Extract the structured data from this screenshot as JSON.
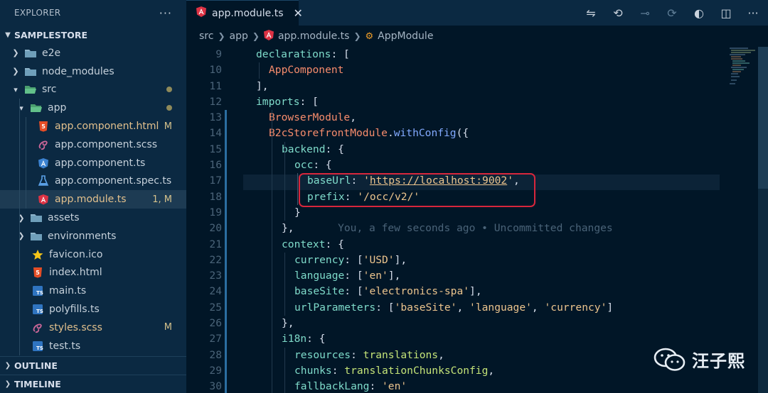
{
  "sidebar": {
    "title": "EXPLORER",
    "more": "···",
    "project": "SAMPLESTORE",
    "items": [
      {
        "label": "e2e",
        "icon": "folder-icon",
        "type": "folder",
        "level": 1,
        "open": false
      },
      {
        "label": "node_modules",
        "icon": "folder-icon",
        "type": "folder",
        "level": 1,
        "open": false
      },
      {
        "label": "src",
        "icon": "folder-open-icon",
        "type": "folder",
        "level": 1,
        "open": true,
        "dot": true
      },
      {
        "label": "app",
        "icon": "folder-open-icon",
        "type": "folder",
        "level": 2,
        "open": true,
        "dot": true
      },
      {
        "label": "app.component.html",
        "icon": "html-icon",
        "type": "file",
        "level": 3,
        "badge": "M"
      },
      {
        "label": "app.component.scss",
        "icon": "sass-icon",
        "type": "file",
        "level": 3
      },
      {
        "label": "app.component.ts",
        "icon": "angular-component-icon",
        "type": "file",
        "level": 3
      },
      {
        "label": "app.component.spec.ts",
        "icon": "test-flask-icon",
        "type": "file",
        "level": 3
      },
      {
        "label": "app.module.ts",
        "icon": "angular-icon",
        "type": "file",
        "level": 3,
        "badge": "1, M",
        "selected": true
      },
      {
        "label": "assets",
        "icon": "folder-icon",
        "type": "folder",
        "level": 2,
        "open": false
      },
      {
        "label": "environments",
        "icon": "folder-icon",
        "type": "folder",
        "level": 2,
        "open": false
      },
      {
        "label": "favicon.ico",
        "icon": "star-icon",
        "type": "file",
        "level": 2
      },
      {
        "label": "index.html",
        "icon": "html-icon",
        "type": "file",
        "level": 2
      },
      {
        "label": "main.ts",
        "icon": "typescript-icon",
        "type": "file",
        "level": 2
      },
      {
        "label": "polyfills.ts",
        "icon": "typescript-icon",
        "type": "file",
        "level": 2
      },
      {
        "label": "styles.scss",
        "icon": "sass-icon",
        "type": "file",
        "level": 2,
        "badge": "M"
      },
      {
        "label": "test.ts",
        "icon": "typescript-icon",
        "type": "file",
        "level": 2
      }
    ],
    "outline": "OUTLINE",
    "timeline": "TIMELINE"
  },
  "tab": {
    "label": "app.module.ts",
    "close": "✕"
  },
  "breadcrumb": {
    "parts": [
      "src",
      "app",
      "app.module.ts",
      "AppModule"
    ]
  },
  "code": {
    "lines": [
      {
        "n": "9",
        "tokens": [
          [
            "k",
            "declarations"
          ],
          [
            "pu",
            ": ["
          ]
        ]
      },
      {
        "n": "10",
        "tokens": [
          [
            "cls",
            "AppComponent"
          ]
        ]
      },
      {
        "n": "11",
        "tokens": [
          [
            "pu",
            "],"
          ]
        ]
      },
      {
        "n": "12",
        "tokens": [
          [
            "k",
            "imports"
          ],
          [
            "pu",
            ": ["
          ]
        ]
      },
      {
        "n": "13",
        "tokens": [
          [
            "cls",
            "BrowserModule"
          ],
          [
            "pu",
            ","
          ]
        ]
      },
      {
        "n": "14",
        "tokens": [
          [
            "cls",
            "B2cStorefrontModule"
          ],
          [
            "pu",
            "."
          ],
          [
            "fn",
            "withConfig"
          ],
          [
            "pu",
            "({"
          ]
        ]
      },
      {
        "n": "15",
        "tokens": [
          [
            "k",
            "backend"
          ],
          [
            "pu",
            ": {"
          ]
        ]
      },
      {
        "n": "16",
        "tokens": [
          [
            "k",
            "occ"
          ],
          [
            "pu",
            ": {"
          ]
        ]
      },
      {
        "n": "17",
        "tokens": [
          [
            "k",
            "baseUrl"
          ],
          [
            "pu",
            ": "
          ],
          [
            "s",
            "'"
          ],
          [
            "url",
            "https://localhost:9002"
          ],
          [
            "s",
            "'"
          ],
          [
            "pu",
            ","
          ]
        ]
      },
      {
        "n": "18",
        "tokens": [
          [
            "k",
            "prefix"
          ],
          [
            "pu",
            ": "
          ],
          [
            "s",
            "'/occ/v2/'"
          ]
        ]
      },
      {
        "n": "19",
        "tokens": [
          [
            "pu",
            "}"
          ]
        ]
      },
      {
        "n": "20",
        "tokens": [
          [
            "pu",
            "},"
          ],
          [
            "blame",
            "       You, a few seconds ago • Uncommitted changes"
          ]
        ]
      },
      {
        "n": "21",
        "tokens": [
          [
            "k",
            "context"
          ],
          [
            "pu",
            ": {"
          ]
        ]
      },
      {
        "n": "22",
        "tokens": [
          [
            "k",
            "currency"
          ],
          [
            "pu",
            ": ["
          ],
          [
            "s",
            "'USD'"
          ],
          [
            "pu",
            "],"
          ]
        ]
      },
      {
        "n": "23",
        "tokens": [
          [
            "k",
            "language"
          ],
          [
            "pu",
            ": ["
          ],
          [
            "s",
            "'en'"
          ],
          [
            "pu",
            "],"
          ]
        ]
      },
      {
        "n": "24",
        "tokens": [
          [
            "k",
            "baseSite"
          ],
          [
            "pu",
            ": ["
          ],
          [
            "s",
            "'electronics-spa'"
          ],
          [
            "pu",
            "],"
          ]
        ]
      },
      {
        "n": "25",
        "tokens": [
          [
            "k",
            "urlParameters"
          ],
          [
            "pu",
            ": ["
          ],
          [
            "s",
            "'baseSite'"
          ],
          [
            "pu",
            ", "
          ],
          [
            "s",
            "'language'"
          ],
          [
            "pu",
            ", "
          ],
          [
            "s",
            "'currency'"
          ],
          [
            "pu",
            "]"
          ]
        ]
      },
      {
        "n": "26",
        "tokens": [
          [
            "pu",
            "},"
          ]
        ]
      },
      {
        "n": "27",
        "tokens": [
          [
            "k",
            "i18n"
          ],
          [
            "pu",
            ": {"
          ]
        ]
      },
      {
        "n": "28",
        "tokens": [
          [
            "k",
            "resources"
          ],
          [
            "pu",
            ": "
          ],
          [
            "p",
            "translations"
          ],
          [
            "pu",
            ","
          ]
        ]
      },
      {
        "n": "29",
        "tokens": [
          [
            "k",
            "chunks"
          ],
          [
            "pu",
            ": "
          ],
          [
            "p",
            "translationChunksConfig"
          ],
          [
            "pu",
            ","
          ]
        ]
      },
      {
        "n": "30",
        "tokens": [
          [
            "k",
            "fallbackLang"
          ],
          [
            "pu",
            ": "
          ],
          [
            "s",
            "'en'"
          ]
        ]
      }
    ]
  },
  "watermark": {
    "text": "汪子熙"
  },
  "colors": {
    "accent": "#2b6ea1",
    "highlight_box": "#d8263c",
    "background": "#011627",
    "sidebar": "#0b2942"
  }
}
